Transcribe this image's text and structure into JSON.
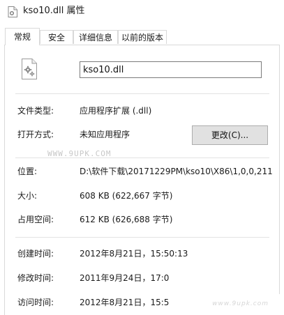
{
  "window": {
    "title": "kso10.dll 属性"
  },
  "tabs": [
    {
      "label": "常规",
      "active": true
    },
    {
      "label": "安全",
      "active": false
    },
    {
      "label": "详细信息",
      "active": false
    },
    {
      "label": "以前的版本",
      "active": false
    }
  ],
  "file": {
    "name": "kso10.dll",
    "icon": "dll-gear-file-icon"
  },
  "props": {
    "type_label": "文件类型:",
    "type_value": "应用程序扩展 (.dll)",
    "opens_label": "打开方式:",
    "opens_value": "未知应用程序",
    "change_button": "更改(C)...",
    "location_label": "位置:",
    "location_value": "D:\\软件下载\\20171229PM\\kso10\\X86\\1,0,0,211",
    "size_label": "大小:",
    "size_value": "608 KB (622,667 字节)",
    "disk_label": "占用空间:",
    "disk_value": "612 KB (626,688 字节)",
    "created_label": "创建时间:",
    "created_value": "2012年8月21日，15:50:13",
    "modified_label": "修改时间:",
    "modified_value": "2011年9月24日，17:0",
    "accessed_label": "访问时间:",
    "accessed_value": "2012年8月21日，15:5"
  },
  "watermarks": {
    "top": "WWW.9UPK.COM",
    "bottom": "www.9upk.com"
  },
  "colors": {
    "border": "#d9d9d9",
    "button_bg": "#e1e1e1",
    "input_border": "#7a7a7a"
  }
}
